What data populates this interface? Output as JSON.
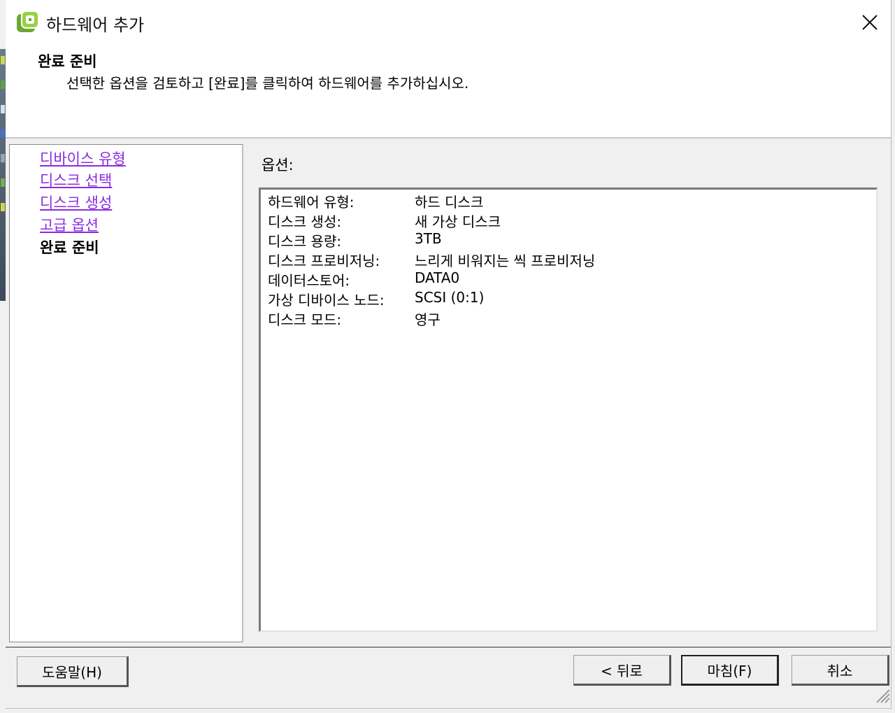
{
  "window": {
    "title": "하드웨어 추가",
    "icon": "vsphere-app-icon",
    "close_icon": "close-icon"
  },
  "header": {
    "step_title": "완료 준비",
    "step_description": "선택한 옵션을 검토하고 [완료]를 클릭하여 하드웨어를 추가하십시오."
  },
  "nav": {
    "items": [
      {
        "label": "디바이스 유형",
        "state": "visited"
      },
      {
        "label": "디스크 선택",
        "state": "visited"
      },
      {
        "label": "디스크 생성",
        "state": "visited"
      },
      {
        "label": "고급 옵션",
        "state": "visited"
      },
      {
        "label": "완료 준비",
        "state": "current"
      }
    ],
    "visited_color": "#8a2be2"
  },
  "options": {
    "label": "옵션:",
    "rows": [
      {
        "key": "하드웨어 유형:",
        "value": "하드 디스크"
      },
      {
        "key": "디스크 생성:",
        "value": "새 가상 디스크"
      },
      {
        "key": "디스크 용량:",
        "value": "3TB"
      },
      {
        "key": "디스크 프로비저닝:",
        "value": "느리게 비워지는 씩 프로비저닝"
      },
      {
        "key": "데이터스토어:",
        "value": "DATA0"
      },
      {
        "key": "가상 디바이스 노드:",
        "value": "SCSI (0:1)"
      },
      {
        "key": "디스크 모드:",
        "value": "영구"
      }
    ]
  },
  "buttons": {
    "help": "도움말(H)",
    "back": "< 뒤로",
    "finish": "마침(F)",
    "cancel": "취소"
  }
}
